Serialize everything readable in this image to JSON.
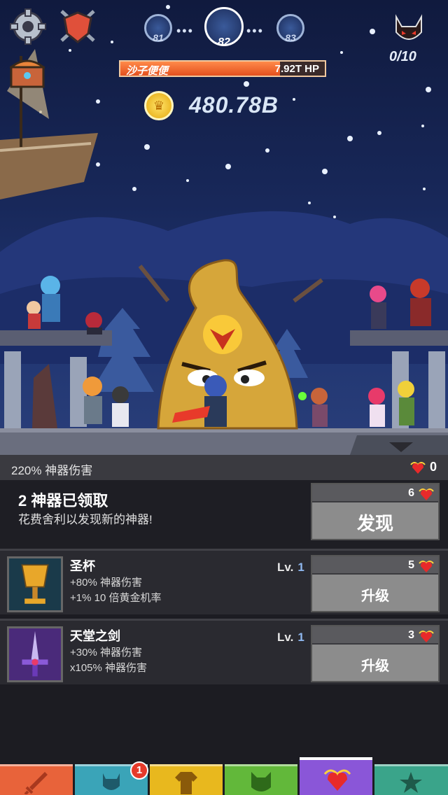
{
  "hud": {
    "stage_prev": "81",
    "stage_current": "82",
    "stage_next": "83",
    "boss_kills": "0/10",
    "enemy_name": "沙子便便",
    "enemy_hp": "7.92T HP",
    "enemy_hp_fraction": 0.78,
    "gold": "480.78B"
  },
  "artifact_panel": {
    "bonus_text": "220% 神器伤害",
    "relic_count": "0",
    "owned_title": "2 神器已领取",
    "owned_subtitle": "花费舍利以发现新的神器!",
    "discover": {
      "cost": "6",
      "label": "发现"
    },
    "items": [
      {
        "name": "圣杯",
        "line1": "+80% 神器伤害",
        "line2": "+1% 10 倍黄金机率",
        "level_label": "Lv.",
        "level": "1",
        "cost": "5",
        "button": "升级"
      },
      {
        "name": "天堂之剑",
        "line1": "+30% 神器伤害",
        "line2": "x105% 神器伤害",
        "level_label": "Lv.",
        "level": "1",
        "cost": "3",
        "button": "升级"
      }
    ]
  },
  "nav": {
    "tabs": [
      "sword",
      "heroes",
      "equipment",
      "pets",
      "artifacts",
      "shop"
    ],
    "active": "artifacts",
    "hero_badge": "1"
  },
  "colors": {
    "nav_sword": "#e8633a",
    "nav_heroes": "#3aa4b8",
    "nav_equipment": "#e8b81e",
    "nav_pets": "#62b83a",
    "nav_artifacts": "#8a56d8",
    "nav_shop": "#3aa48a",
    "hp_fill": "#e4501e"
  }
}
